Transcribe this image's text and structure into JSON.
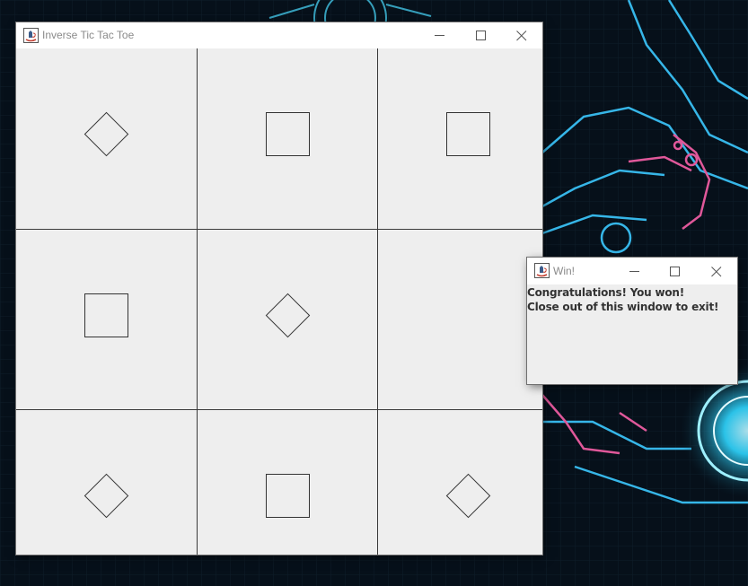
{
  "main_window": {
    "title": "Inverse Tic Tac Toe",
    "board": [
      [
        "diamond",
        "square",
        "square"
      ],
      [
        "square",
        "diamond",
        ""
      ],
      [
        "diamond",
        "square",
        "diamond"
      ]
    ]
  },
  "win_dialog": {
    "title": "Win!",
    "message_line1": "Congratulations! You won!",
    "message_line2": "Close out of this window to exit!"
  },
  "icons": {
    "minimize": "minimize-icon",
    "maximize": "maximize-icon",
    "close": "close-icon",
    "app": "java-app-icon"
  },
  "colors": {
    "window_bg": "#eeeeee",
    "titlebar_bg": "#ffffff",
    "title_text": "#8a8a8a",
    "grid_line": "#3a3a3a",
    "wallpaper_accent_cyan": "#2fd6ff",
    "wallpaper_accent_pink": "#e0589a"
  }
}
